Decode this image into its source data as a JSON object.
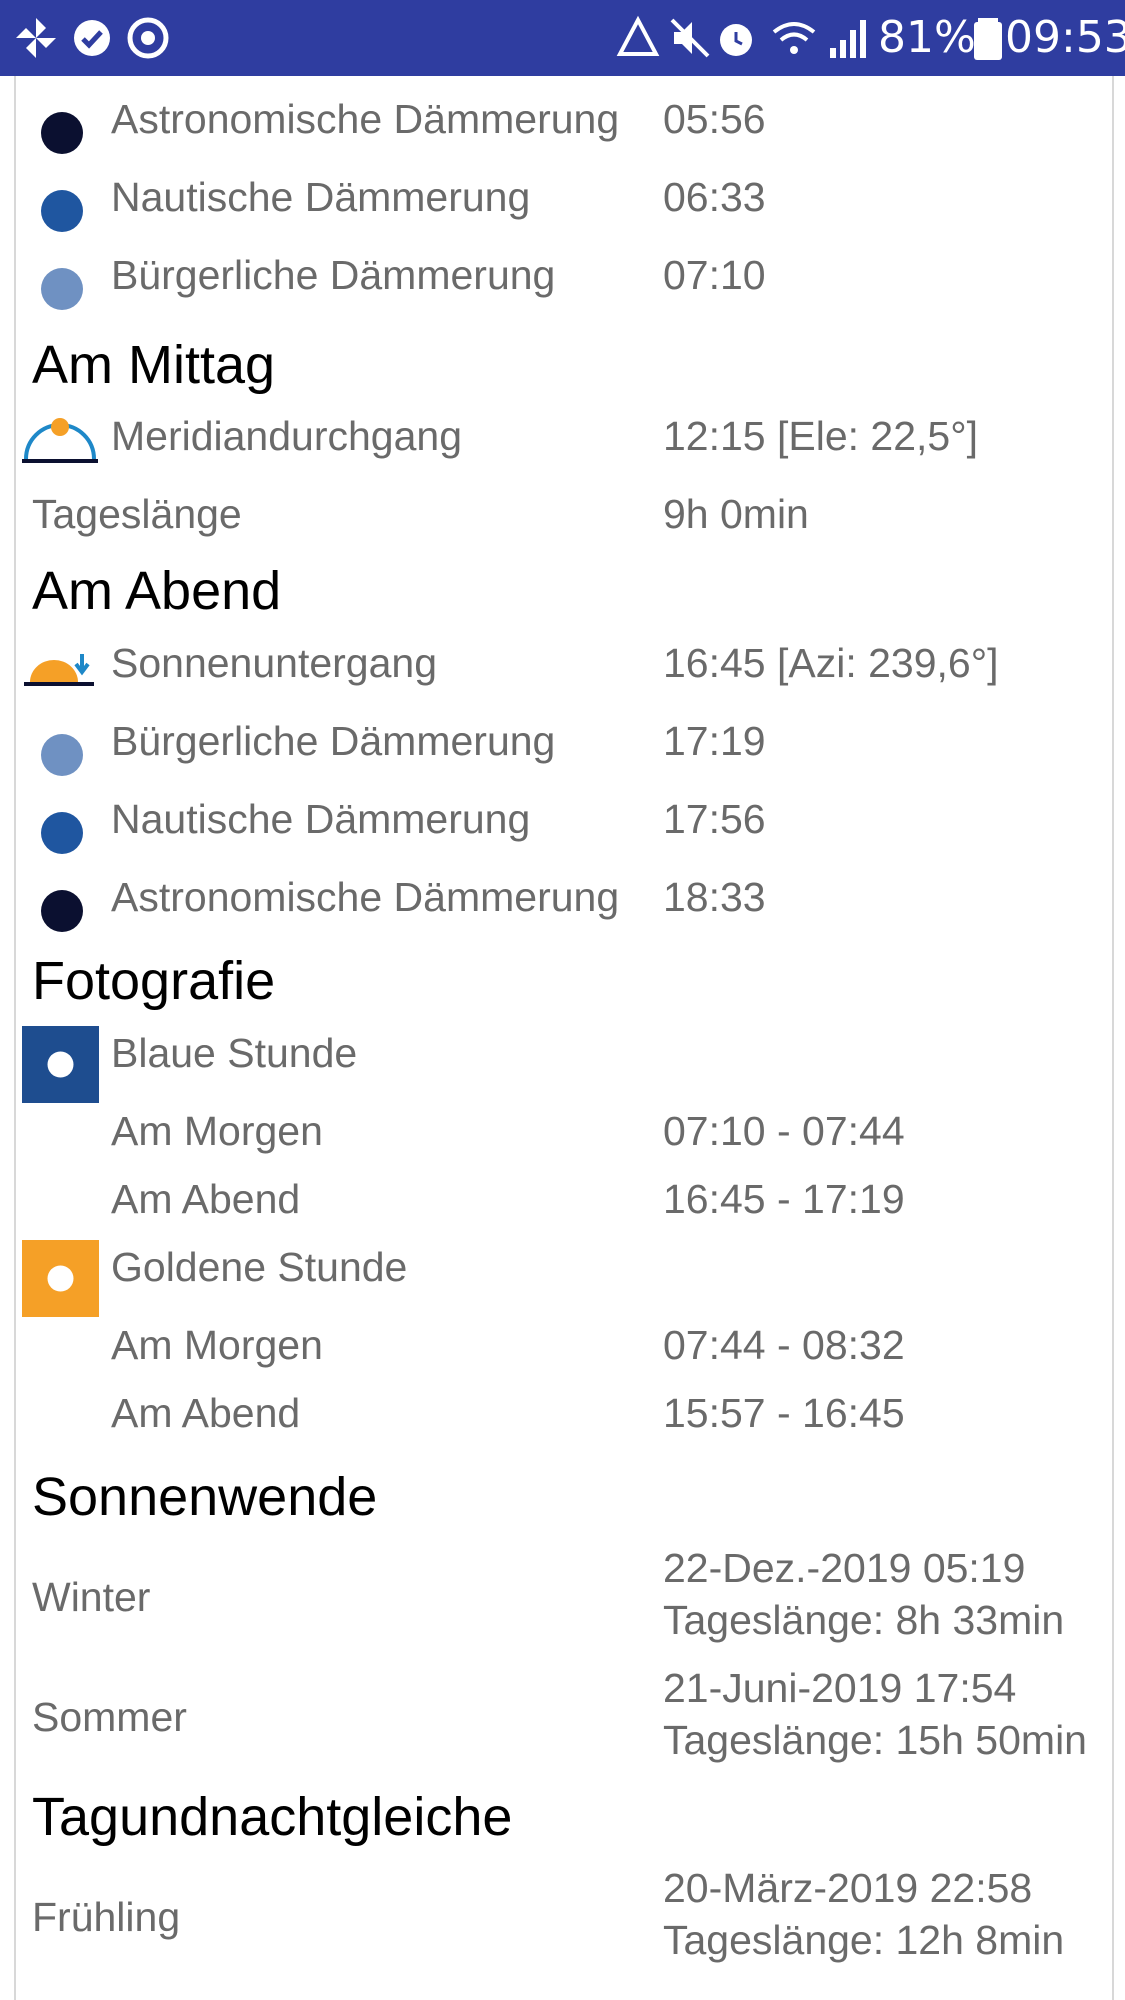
{
  "status_bar": {
    "battery_percent": "81%",
    "time": "09:53",
    "background": "#2f3da0"
  },
  "colors": {
    "astro": "#0b1030",
    "nautical": "#1f56a0",
    "civil": "#6f91c2",
    "blue_hour": "#1e4d8f",
    "golden_hour": "#f5a027"
  },
  "morning_twilight": [
    {
      "label": "Astronomische Dämmerung",
      "value": "05:56",
      "icon": "dark-navy-dot-icon"
    },
    {
      "label": "Nautische Dämmerung",
      "value": "06:33",
      "icon": "blue-dot-icon"
    },
    {
      "label": "Bürgerliche Dämmerung",
      "value": "07:10",
      "icon": "light-blue-dot-icon"
    }
  ],
  "noon": {
    "heading": "Am Mittag",
    "transit_label": "Meridiandurchgang",
    "transit_value": "12:15 [Ele: 22,5°]",
    "daylength_label": "Tageslänge",
    "daylength_value": "9h 0min"
  },
  "evening": {
    "heading": "Am Abend",
    "sunset_label": "Sonnenuntergang",
    "sunset_value": "16:45 [Azi: 239,6°]",
    "twilight": [
      {
        "label": "Bürgerliche Dämmerung",
        "value": "17:19",
        "icon": "light-blue-dot-icon"
      },
      {
        "label": "Nautische Dämmerung",
        "value": "17:56",
        "icon": "blue-dot-icon"
      },
      {
        "label": "Astronomische Dämmerung",
        "value": "18:33",
        "icon": "dark-navy-dot-icon"
      }
    ]
  },
  "photography": {
    "heading": "Fotografie",
    "blue_hour": {
      "title": "Blaue Stunde",
      "morning_label": "Am Morgen",
      "morning_value": "07:10 - 07:44",
      "evening_label": "Am Abend",
      "evening_value": "16:45 - 17:19"
    },
    "golden_hour": {
      "title": "Goldene Stunde",
      "morning_label": "Am Morgen",
      "morning_value": "07:44 - 08:32",
      "evening_label": "Am Abend",
      "evening_value": "15:57 - 16:45"
    }
  },
  "solstice": {
    "heading": "Sonnenwende",
    "winter_label": "Winter",
    "winter_date": "22-Dez.-2019 05:19",
    "winter_daylength": "Tageslänge: 8h 33min",
    "summer_label": "Sommer",
    "summer_date": "21-Juni-2019 17:54",
    "summer_daylength": "Tageslänge: 15h 50min"
  },
  "equinox": {
    "heading": "Tagundnachtgleiche",
    "spring_label": "Frühling",
    "spring_date": "20-März-2019 22:58",
    "spring_daylength": "Tageslänge: 12h 8min"
  }
}
